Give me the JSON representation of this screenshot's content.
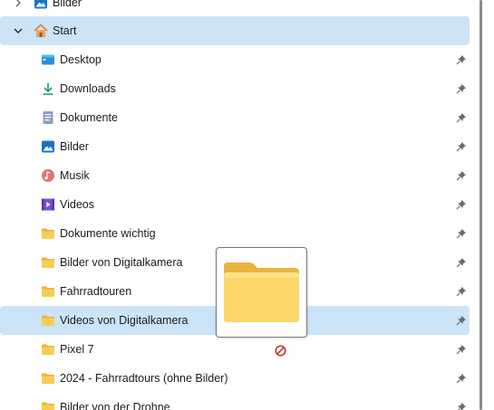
{
  "nav": {
    "top_partial": {
      "label": "Bilder",
      "icon": "pictures-icon"
    },
    "start": {
      "label": "Start",
      "icon": "home-icon"
    },
    "items": [
      {
        "label": "Desktop",
        "icon": "desktop-icon"
      },
      {
        "label": "Downloads",
        "icon": "downloads-icon"
      },
      {
        "label": "Dokumente",
        "icon": "documents-icon"
      },
      {
        "label": "Bilder",
        "icon": "pictures-icon"
      },
      {
        "label": "Musik",
        "icon": "music-icon"
      },
      {
        "label": "Videos",
        "icon": "videos-icon"
      },
      {
        "label": "Dokumente wichtig",
        "icon": "folder-icon"
      },
      {
        "label": "Bilder von Digitalkamera",
        "icon": "folder-icon"
      },
      {
        "label": "Fahrradtouren",
        "icon": "folder-icon"
      },
      {
        "label": "Videos von Digitalkamera",
        "icon": "folder-icon",
        "selected": true
      },
      {
        "label": "Pixel 7",
        "icon": "folder-icon"
      },
      {
        "label": "2024 - Fahrradtours (ohne Bilder)",
        "icon": "folder-icon"
      },
      {
        "label": "Bilder von der Drohne",
        "icon": "folder-icon"
      }
    ]
  },
  "drag": {
    "icon": "folder-icon",
    "cursor_icon": "no-drop-icon"
  },
  "colors": {
    "selection": "#cce4f7",
    "folder": "#f8cd55",
    "pin": "#6b6b6b",
    "no_drop": "#c42b1c"
  }
}
